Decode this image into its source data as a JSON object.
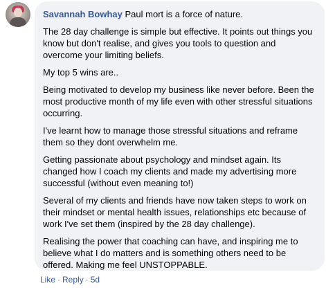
{
  "comment": {
    "author": "Savannah Bowhay",
    "lead_text": "Paul mort is a force of nature.",
    "paragraphs": [
      "The 28 day challenge is simple but effective. It points out things you know but don't realise, and gives you tools to question and overcome your limiting beliefs.",
      "My top 5 wins are..",
      "Being motivated to develop my business like never before. Been the most productive month of my life even with other stressful situations occurring.",
      "I've learnt how to manage those stressful situations and reframe them so they dont overwhelm me.",
      "Getting passionate about psychology and mindset again. Its changed how I coach my clients and made my advertising more successful (without even meaning to!)",
      "Several of my clients and friends have now taken steps to work on their mindset or mental health issues, relationships etc because of work I've set them (inspired by the 28 day challenge).",
      "Realising the power that coaching can have, and inspiring me to believe what I do matters and is something others need to be offered. Making me feel UNSTOPPABLE."
    ]
  },
  "actions": {
    "like_label": "Like",
    "reply_label": "Reply",
    "separator": "·",
    "timestamp": "5d"
  },
  "colors": {
    "bubble_background": "#f0f2f5",
    "author_name": "#385898",
    "body_text": "#050505",
    "meta_text": "#65676b"
  }
}
